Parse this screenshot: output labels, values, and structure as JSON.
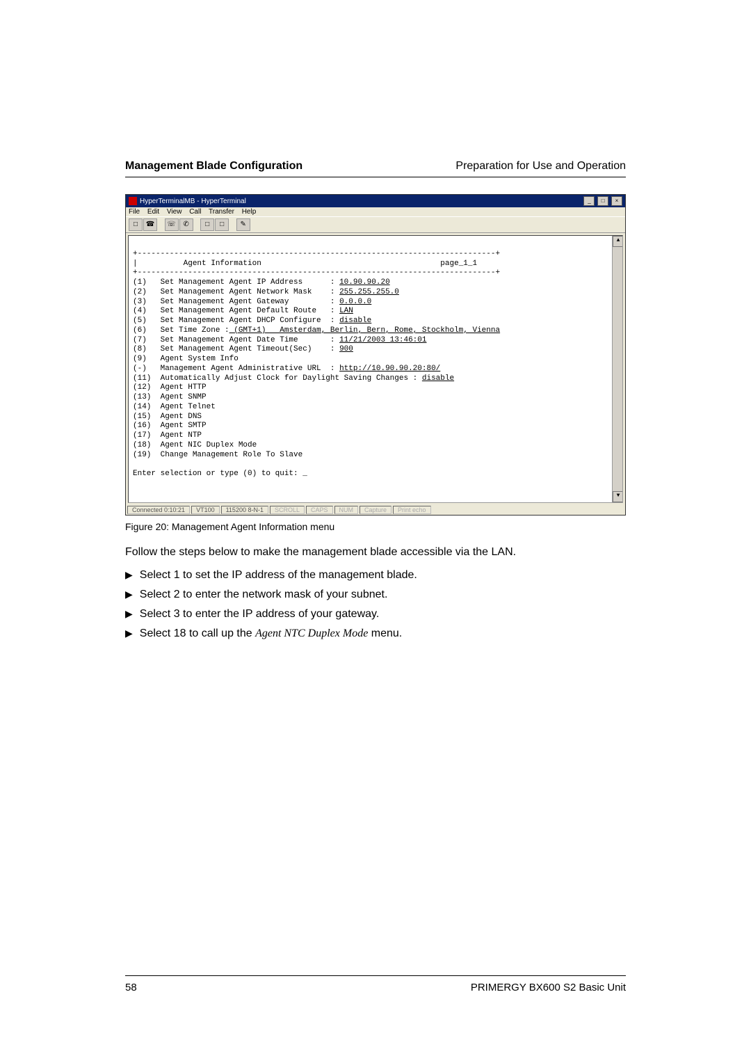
{
  "header": {
    "left": "Management Blade Configuration",
    "right": "Preparation for Use and Operation"
  },
  "window": {
    "title": "HyperTerminalMB - HyperTerminal",
    "minimize": "_",
    "maximize": "□",
    "close": "×",
    "menu": {
      "file": "File",
      "edit": "Edit",
      "view": "View",
      "call": "Call",
      "transfer": "Transfer",
      "help": "Help"
    }
  },
  "terminal": {
    "border_top": "+------------------------------------------------------------------------------+",
    "header_line_left": "|          Agent Information",
    "header_line_right": "page_1_1",
    "border_mid": "+------------------------------------------------------------------------------+",
    "rows": [
      {
        "n": "(1)",
        "label": "Set Management Agent IP Address",
        "sep": ": ",
        "val": "10.90.90.20",
        "u": true
      },
      {
        "n": "(2)",
        "label": "Set Management Agent Network Mask",
        "sep": ": ",
        "val": "255.255.255.0",
        "u": true
      },
      {
        "n": "(3)",
        "label": "Set Management Agent Gateway",
        "sep": ": ",
        "val": "0.0.0.0",
        "u": true
      },
      {
        "n": "(4)",
        "label": "Set Management Agent Default Route",
        "sep": ": ",
        "val": "LAN",
        "u": true
      },
      {
        "n": "(5)",
        "label": "Set Management Agent DHCP Configure",
        "sep": ": ",
        "val": "disable",
        "u": true
      },
      {
        "n": "(6)",
        "label": "Set Time Zone :",
        "after": " (GMT+1)   Amsterdam, Berlin, Bern, Rome, Stockholm, Vienna",
        "after_u": true
      },
      {
        "n": "(7)",
        "label": "Set Management Agent Date Time",
        "sep": ": ",
        "val": "11/21/2003 13:46:01",
        "u": true
      },
      {
        "n": "(8)",
        "label": "Set Management Agent Timeout(Sec)",
        "sep": ": ",
        "val": "900",
        "u": true
      },
      {
        "n": "(9)",
        "label": "Agent System Info"
      },
      {
        "n": "(-)",
        "label": "Management Agent Administrative URL",
        "sep": ": ",
        "val": "http://10.90.90.20:80/",
        "u": true
      },
      {
        "n": "(11)",
        "label": "Automatically Adjust Clock for Daylight Saving Changes : ",
        "val": "disable",
        "u": true,
        "nosep": true
      },
      {
        "n": "(12)",
        "label": "Agent HTTP"
      },
      {
        "n": "(13)",
        "label": "Agent SNMP"
      },
      {
        "n": "(14)",
        "label": "Agent Telnet"
      },
      {
        "n": "(15)",
        "label": "Agent DNS"
      },
      {
        "n": "(16)",
        "label": "Agent SMTP"
      },
      {
        "n": "(17)",
        "label": "Agent NTP"
      },
      {
        "n": "(18)",
        "label": "Agent NIC Duplex Mode"
      },
      {
        "n": "(19)",
        "label": "Change Management Role To Slave"
      }
    ],
    "prompt": "Enter selection or type (0) to quit: _"
  },
  "statusbar": {
    "connected": "Connected 0:10:21",
    "emu": "VT100",
    "baud": "115200 8-N-1",
    "scroll": "SCROLL",
    "caps": "CAPS",
    "num": "NUM",
    "capture": "Capture",
    "echo": "Print echo"
  },
  "caption": "Figure 20: Management Agent Information menu",
  "bodytext": "Follow the steps below to make the management blade accessible via the LAN.",
  "steps": [
    {
      "t": "Select 1 to set the IP address of the management blade."
    },
    {
      "t": "Select 2 to enter the network mask of your subnet."
    },
    {
      "t": "Select 3 to enter the IP address of your gateway."
    },
    {
      "prefix": "Select 18 to call up the ",
      "italic": "Agent NTC Duplex Mode",
      "suffix": " menu."
    }
  ],
  "footer": {
    "page": "58",
    "title": "PRIMERGY BX600 S2 Basic Unit"
  }
}
